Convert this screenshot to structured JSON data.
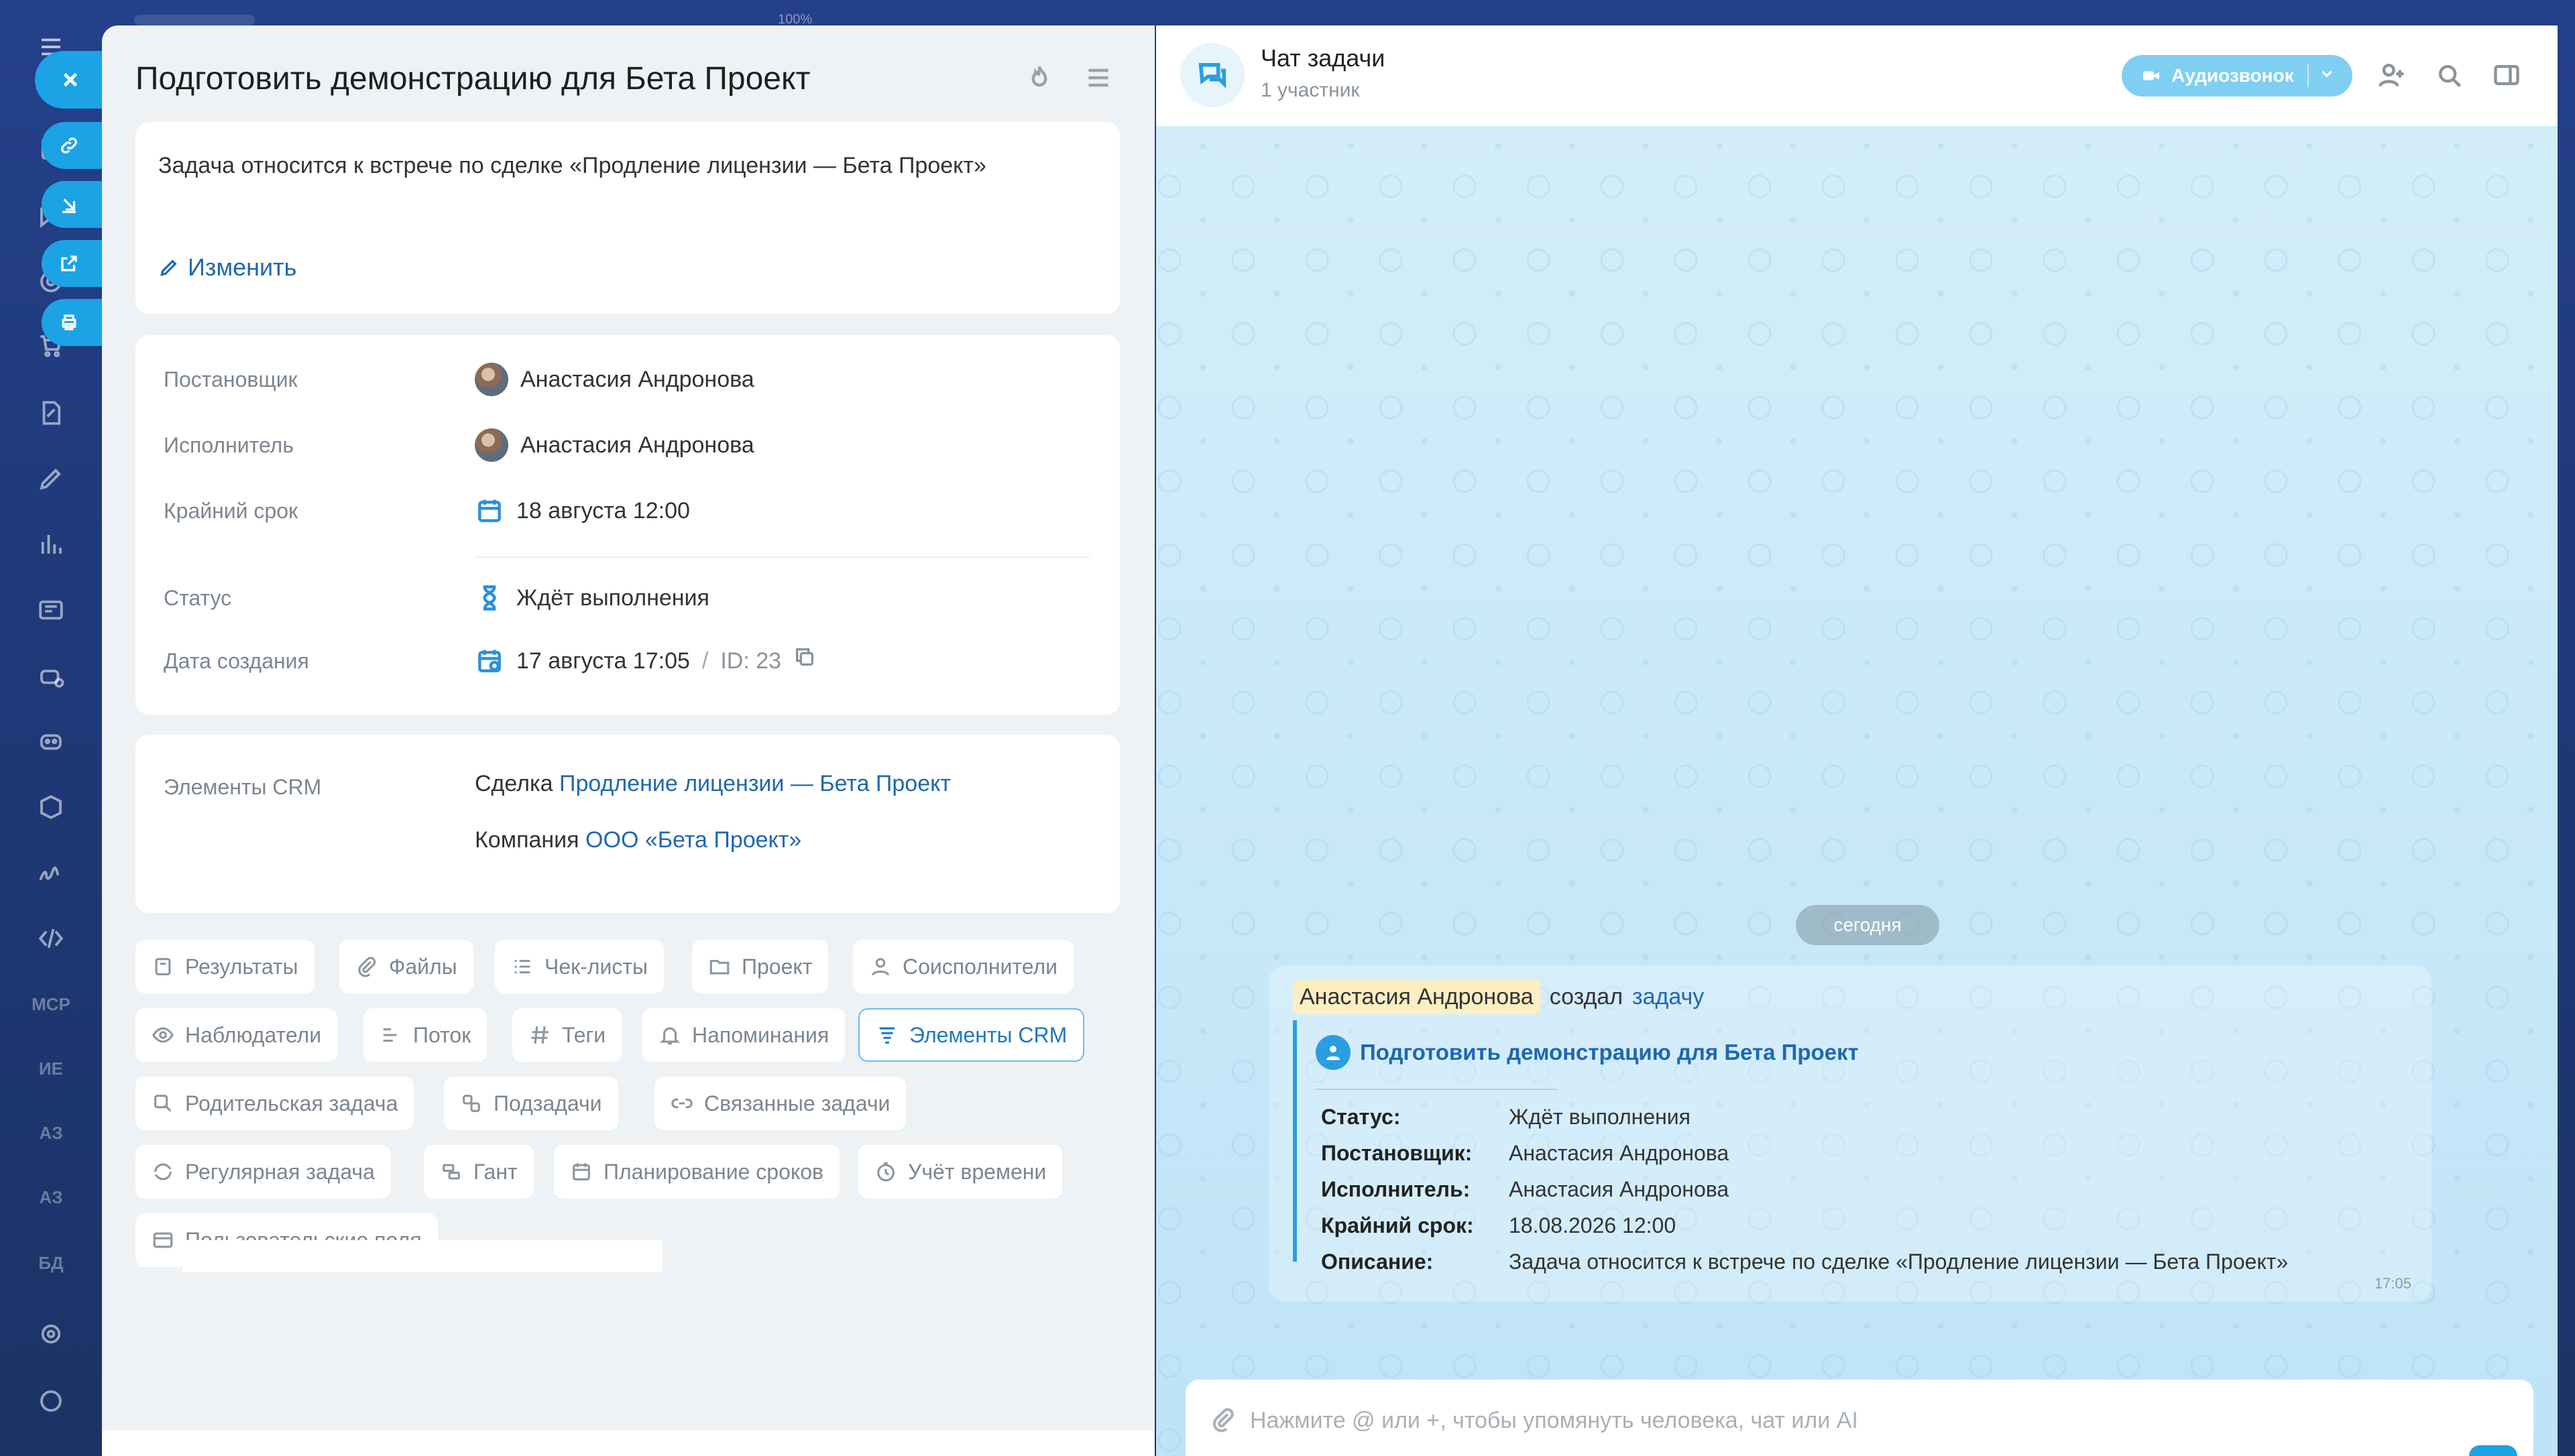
{
  "browser": {
    "zoom": "100%"
  },
  "rail": {
    "mcp_label": "MCP",
    "item1": "ИЕ",
    "item2": "АЗ",
    "item3": "АЗ",
    "item4": "БД"
  },
  "task": {
    "title": "Подготовить демонстрацию для Бета Проект",
    "description": "Задача относится к встрече по сделке «Продление лицензии — Бета Проект»",
    "edit_label": "Изменить",
    "props": {
      "creator_label": "Постановщик",
      "creator_value": "Анастасия Андронова",
      "assignee_label": "Исполнитель",
      "assignee_value": "Анастасия Андронова",
      "deadline_label": "Крайний срок",
      "deadline_value": "18 августа 12:00",
      "status_label": "Статус",
      "status_value": "Ждёт выполнения",
      "created_label": "Дата создания",
      "created_value": "17 августа 17:05",
      "sep": "/",
      "id_value": "ID: 23"
    },
    "crm": {
      "label": "Элементы CRM",
      "deal_prefix": "Сделка",
      "deal_link": "Продление лицензии — Бета Проект",
      "company_prefix": "Компания",
      "company_link": "ООО «Бета Проект»"
    },
    "chips": {
      "results": "Результаты",
      "files": "Файлы",
      "checklists": "Чек-листы",
      "project": "Проект",
      "coexecutors": "Соисполнители",
      "observers": "Наблюдатели",
      "flow": "Поток",
      "tags": "Теги",
      "reminders": "Напоминания",
      "crm": "Элементы CRM",
      "parent": "Родительская задача",
      "subtasks": "Подзадачи",
      "related": "Связанные задачи",
      "recurring": "Регулярная задача",
      "gantt": "Гант",
      "planning": "Планирование сроков",
      "time": "Учёт времени",
      "custom": "Пользовательские поля"
    }
  },
  "chat": {
    "title": "Чат задачи",
    "subtitle": "1 участник",
    "call_label": "Аудиозвонок",
    "date_pill": "сегодня",
    "message": {
      "author": "Анастасия Андронова",
      "verb": "создал",
      "link": "задачу",
      "quote_title": "Подготовить демонстрацию для Бета Проект",
      "status_k": "Статус:",
      "status_v": "Ждёт выполнения",
      "creator_k": "Постановщик:",
      "creator_v": "Анастасия Андронова",
      "assignee_k": "Исполнитель:",
      "assignee_v": "Анастасия Андронова",
      "deadline_k": "Крайний срок:",
      "deadline_v": "18.08.2026 12:00",
      "desc_k": "Описание:",
      "desc_v": "Задача относится к встрече по сделке «Продление лицензии — Бета Проект»",
      "time": "17:05"
    },
    "composer_placeholder": "Нажмите @ или +, чтобы упомянуть человека, чат или AI"
  },
  "colors": {
    "accent": "#1ba3e6",
    "link": "#2067b0",
    "chat_bg": "#c9e9f8"
  }
}
